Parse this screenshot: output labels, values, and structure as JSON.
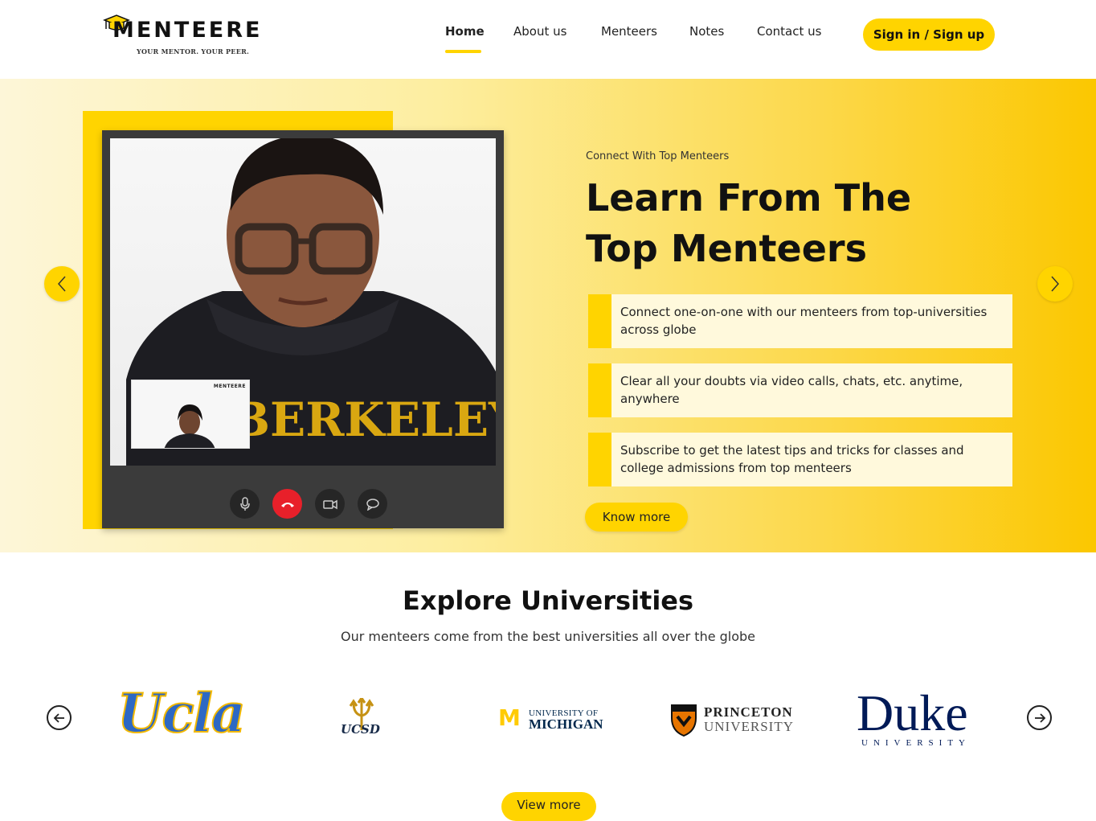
{
  "brand": {
    "name": "MENTEERE",
    "tagline": "YOUR MENTOR. YOUR PEER.",
    "primary_color": "#ffd400"
  },
  "nav": {
    "items": [
      {
        "label": "Home",
        "active": true
      },
      {
        "label": "About us"
      },
      {
        "label": "Menteers"
      },
      {
        "label": "Notes"
      },
      {
        "label": "Contact us"
      }
    ],
    "sign_button": "Sign in / Sign up"
  },
  "hero": {
    "kicker": "Connect With Top Menteers",
    "title": "Learn From The Top Menteers",
    "features": [
      "Connect one-on-one with our menteers from top-universities across globe",
      "Clear all your doubts via video calls, chats, etc. anytime, anywhere",
      "Subscribe to get the latest tips and tricks for classes and college admissions from top menteers"
    ],
    "cta": "Know more",
    "video_call": {
      "shirt_text": "BERKELEY",
      "pip_brand": "MENTEERE",
      "controls": [
        "microphone-icon",
        "end-call-icon",
        "camera-icon",
        "chat-icon"
      ]
    }
  },
  "universities": {
    "title": "Explore Universities",
    "subtitle": "Our menteers come from the best universities all over the globe",
    "logos": [
      {
        "name": "Ucla"
      },
      {
        "name": "UCSD"
      },
      {
        "name": "UNIVERSITY OF MICHIGAN",
        "line1": "UNIVERSITY OF",
        "line2": "MICHIGAN",
        "mark": "M"
      },
      {
        "name": "PRINCETON UNIVERSITY",
        "line1": "PRINCETON",
        "line2": "UNIVERSITY"
      },
      {
        "name": "Duke UNIVERSITY",
        "line1": "Duke",
        "line2": "UNIVERSITY"
      }
    ],
    "view_more": "View more"
  }
}
